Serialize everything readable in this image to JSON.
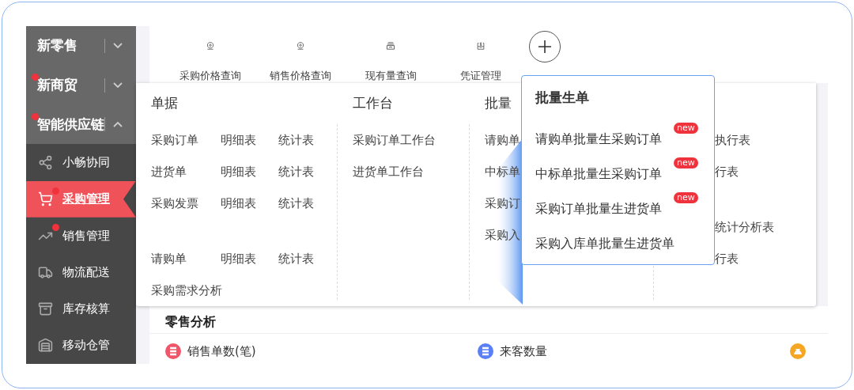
{
  "sidebar": {
    "groups": [
      {
        "label": "新零售",
        "expanded": false,
        "dot": false
      },
      {
        "label": "新商贸",
        "expanded": false,
        "dot": true
      },
      {
        "label": "智能供应链",
        "expanded": true,
        "dot": true,
        "children": [
          {
            "label": "小畅协同",
            "selected": false,
            "dot": false
          },
          {
            "label": "采购管理",
            "selected": true,
            "dot": true
          },
          {
            "label": "销售管理",
            "selected": false,
            "dot": true
          },
          {
            "label": "物流配送",
            "selected": false,
            "dot": false
          },
          {
            "label": "库存核算",
            "selected": false,
            "dot": false
          },
          {
            "label": "移动仓管",
            "selected": false,
            "dot": false
          }
        ]
      }
    ]
  },
  "toolbar": {
    "shortcuts": [
      {
        "label": "采购价格查询"
      },
      {
        "label": "销售价格查询"
      },
      {
        "label": "现有量查询"
      },
      {
        "label": "凭证管理"
      }
    ]
  },
  "menu": {
    "columns": [
      {
        "title": "单据",
        "sections": [
          [
            [
              "采购订单",
              "明细表",
              "统计表"
            ],
            [
              "进货单",
              "明细表",
              "统计表"
            ],
            [
              "采购发票",
              "明细表",
              "统计表"
            ]
          ],
          [
            [
              "请购单",
              "明细表",
              "统计表"
            ],
            [
              "采购需求分析"
            ]
          ]
        ]
      },
      {
        "title": "工作台",
        "sections": [
          [
            [
              "采购订单工作台"
            ],
            [
              "进货单工作台"
            ]
          ]
        ]
      },
      {
        "title": "批量",
        "sections": [
          [
            [
              "请购单"
            ],
            [
              "中标单"
            ],
            [
              "采购订"
            ],
            [
              "采购入"
            ]
          ]
        ]
      },
      {
        "sections": [
          [
            [
              "执行表"
            ],
            [
              "行表"
            ]
          ],
          [
            [
              "统计分析表"
            ],
            [
              "行表"
            ]
          ]
        ]
      }
    ]
  },
  "popover": {
    "title": "批量生单",
    "items": [
      {
        "label": "请购单批量生采购订单",
        "badge": "new"
      },
      {
        "label": "中标单批量生采购订单",
        "badge": "new"
      },
      {
        "label": "采购订单批量生进货单",
        "badge": "new"
      },
      {
        "label": "采购入库单批量生进货单"
      }
    ]
  },
  "analytics": {
    "title": "零售分析",
    "stats": [
      {
        "label": "销售单数(笔)",
        "color": "#f0556a",
        "kind": "list"
      },
      {
        "label": "来客数量",
        "color": "#5b7ff5",
        "kind": "list"
      },
      {
        "color": "#f5a623",
        "kind": "bag"
      }
    ]
  }
}
